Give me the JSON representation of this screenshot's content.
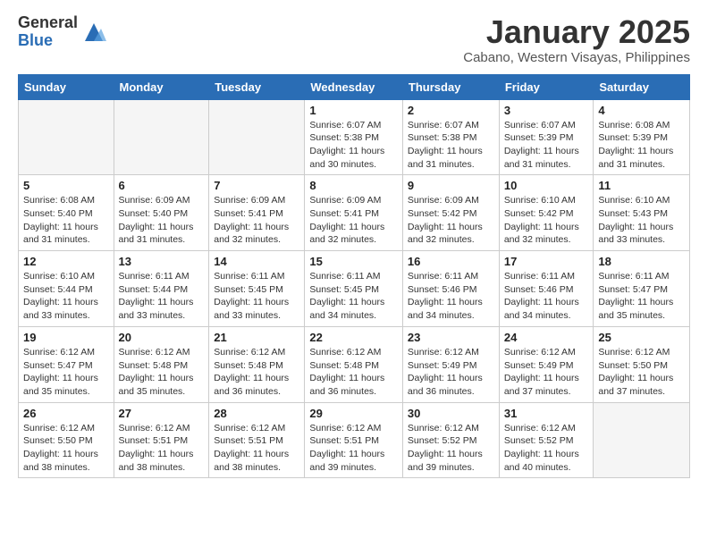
{
  "logo": {
    "general": "General",
    "blue": "Blue"
  },
  "title": "January 2025",
  "location": "Cabano, Western Visayas, Philippines",
  "weekdays": [
    "Sunday",
    "Monday",
    "Tuesday",
    "Wednesday",
    "Thursday",
    "Friday",
    "Saturday"
  ],
  "weeks": [
    [
      {
        "day": "",
        "info": ""
      },
      {
        "day": "",
        "info": ""
      },
      {
        "day": "",
        "info": ""
      },
      {
        "day": "1",
        "info": "Sunrise: 6:07 AM\nSunset: 5:38 PM\nDaylight: 11 hours and 30 minutes."
      },
      {
        "day": "2",
        "info": "Sunrise: 6:07 AM\nSunset: 5:38 PM\nDaylight: 11 hours and 31 minutes."
      },
      {
        "day": "3",
        "info": "Sunrise: 6:07 AM\nSunset: 5:39 PM\nDaylight: 11 hours and 31 minutes."
      },
      {
        "day": "4",
        "info": "Sunrise: 6:08 AM\nSunset: 5:39 PM\nDaylight: 11 hours and 31 minutes."
      }
    ],
    [
      {
        "day": "5",
        "info": "Sunrise: 6:08 AM\nSunset: 5:40 PM\nDaylight: 11 hours and 31 minutes."
      },
      {
        "day": "6",
        "info": "Sunrise: 6:09 AM\nSunset: 5:40 PM\nDaylight: 11 hours and 31 minutes."
      },
      {
        "day": "7",
        "info": "Sunrise: 6:09 AM\nSunset: 5:41 PM\nDaylight: 11 hours and 32 minutes."
      },
      {
        "day": "8",
        "info": "Sunrise: 6:09 AM\nSunset: 5:41 PM\nDaylight: 11 hours and 32 minutes."
      },
      {
        "day": "9",
        "info": "Sunrise: 6:09 AM\nSunset: 5:42 PM\nDaylight: 11 hours and 32 minutes."
      },
      {
        "day": "10",
        "info": "Sunrise: 6:10 AM\nSunset: 5:42 PM\nDaylight: 11 hours and 32 minutes."
      },
      {
        "day": "11",
        "info": "Sunrise: 6:10 AM\nSunset: 5:43 PM\nDaylight: 11 hours and 33 minutes."
      }
    ],
    [
      {
        "day": "12",
        "info": "Sunrise: 6:10 AM\nSunset: 5:44 PM\nDaylight: 11 hours and 33 minutes."
      },
      {
        "day": "13",
        "info": "Sunrise: 6:11 AM\nSunset: 5:44 PM\nDaylight: 11 hours and 33 minutes."
      },
      {
        "day": "14",
        "info": "Sunrise: 6:11 AM\nSunset: 5:45 PM\nDaylight: 11 hours and 33 minutes."
      },
      {
        "day": "15",
        "info": "Sunrise: 6:11 AM\nSunset: 5:45 PM\nDaylight: 11 hours and 34 minutes."
      },
      {
        "day": "16",
        "info": "Sunrise: 6:11 AM\nSunset: 5:46 PM\nDaylight: 11 hours and 34 minutes."
      },
      {
        "day": "17",
        "info": "Sunrise: 6:11 AM\nSunset: 5:46 PM\nDaylight: 11 hours and 34 minutes."
      },
      {
        "day": "18",
        "info": "Sunrise: 6:11 AM\nSunset: 5:47 PM\nDaylight: 11 hours and 35 minutes."
      }
    ],
    [
      {
        "day": "19",
        "info": "Sunrise: 6:12 AM\nSunset: 5:47 PM\nDaylight: 11 hours and 35 minutes."
      },
      {
        "day": "20",
        "info": "Sunrise: 6:12 AM\nSunset: 5:48 PM\nDaylight: 11 hours and 35 minutes."
      },
      {
        "day": "21",
        "info": "Sunrise: 6:12 AM\nSunset: 5:48 PM\nDaylight: 11 hours and 36 minutes."
      },
      {
        "day": "22",
        "info": "Sunrise: 6:12 AM\nSunset: 5:48 PM\nDaylight: 11 hours and 36 minutes."
      },
      {
        "day": "23",
        "info": "Sunrise: 6:12 AM\nSunset: 5:49 PM\nDaylight: 11 hours and 36 minutes."
      },
      {
        "day": "24",
        "info": "Sunrise: 6:12 AM\nSunset: 5:49 PM\nDaylight: 11 hours and 37 minutes."
      },
      {
        "day": "25",
        "info": "Sunrise: 6:12 AM\nSunset: 5:50 PM\nDaylight: 11 hours and 37 minutes."
      }
    ],
    [
      {
        "day": "26",
        "info": "Sunrise: 6:12 AM\nSunset: 5:50 PM\nDaylight: 11 hours and 38 minutes."
      },
      {
        "day": "27",
        "info": "Sunrise: 6:12 AM\nSunset: 5:51 PM\nDaylight: 11 hours and 38 minutes."
      },
      {
        "day": "28",
        "info": "Sunrise: 6:12 AM\nSunset: 5:51 PM\nDaylight: 11 hours and 38 minutes."
      },
      {
        "day": "29",
        "info": "Sunrise: 6:12 AM\nSunset: 5:51 PM\nDaylight: 11 hours and 39 minutes."
      },
      {
        "day": "30",
        "info": "Sunrise: 6:12 AM\nSunset: 5:52 PM\nDaylight: 11 hours and 39 minutes."
      },
      {
        "day": "31",
        "info": "Sunrise: 6:12 AM\nSunset: 5:52 PM\nDaylight: 11 hours and 40 minutes."
      },
      {
        "day": "",
        "info": ""
      }
    ]
  ]
}
